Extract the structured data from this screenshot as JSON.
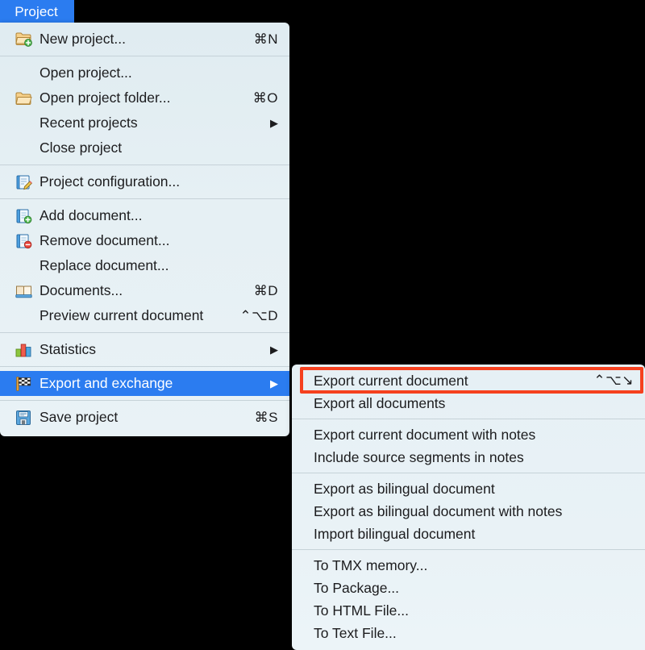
{
  "menubar": {
    "title": "Project"
  },
  "accent": {
    "selection_blue": "#2b7cf0",
    "menu_background": "#e6f0f4",
    "highlight_red": "#f5411f",
    "text": "#1c1c1e"
  },
  "main_menu": {
    "groups": [
      {
        "items": [
          {
            "icon": "new-project-folder-icon",
            "label": "New project...",
            "shortcut": "⌘N",
            "submenu": false
          }
        ]
      },
      {
        "items": [
          {
            "icon": null,
            "label": "Open project...",
            "shortcut": "",
            "submenu": false
          },
          {
            "icon": "open-folder-icon",
            "label": "Open project folder...",
            "shortcut": "⌘O",
            "submenu": false
          },
          {
            "icon": null,
            "label": "Recent projects",
            "shortcut": "",
            "submenu": true
          },
          {
            "icon": null,
            "label": "Close project",
            "shortcut": "",
            "submenu": false
          }
        ]
      },
      {
        "items": [
          {
            "icon": "project-configuration-icon",
            "label": "Project configuration...",
            "shortcut": "",
            "submenu": false
          }
        ]
      },
      {
        "items": [
          {
            "icon": "add-document-icon",
            "label": "Add document...",
            "shortcut": "",
            "submenu": false
          },
          {
            "icon": "remove-document-icon",
            "label": "Remove document...",
            "shortcut": "",
            "submenu": false
          },
          {
            "icon": null,
            "label": "Replace document...",
            "shortcut": "",
            "submenu": false
          },
          {
            "icon": "documents-book-icon",
            "label": "Documents...",
            "shortcut": "⌘D",
            "submenu": false
          },
          {
            "icon": null,
            "label": "Preview current document",
            "shortcut": "⌃⌥D",
            "submenu": false
          }
        ]
      },
      {
        "items": [
          {
            "icon": "statistics-barchart-icon",
            "label": "Statistics",
            "shortcut": "",
            "submenu": true
          }
        ]
      },
      {
        "items": [
          {
            "icon": "export-exchange-flag-icon",
            "label": "Export and exchange",
            "shortcut": "",
            "submenu": true,
            "selected": true
          }
        ]
      },
      {
        "items": [
          {
            "icon": "save-project-floppy-icon",
            "label": "Save project",
            "shortcut": "⌘S",
            "submenu": false
          }
        ]
      }
    ]
  },
  "sub_menu": {
    "groups": [
      {
        "items": [
          {
            "label": "Export current document",
            "shortcut": "⌃⌥↘",
            "highlighted": true
          },
          {
            "label": "Export all documents",
            "shortcut": ""
          }
        ]
      },
      {
        "items": [
          {
            "label": "Export current document with notes",
            "shortcut": ""
          },
          {
            "label": "Include source segments in notes",
            "shortcut": ""
          }
        ]
      },
      {
        "items": [
          {
            "label": "Export as bilingual document",
            "shortcut": ""
          },
          {
            "label": "Export as bilingual document with notes",
            "shortcut": ""
          },
          {
            "label": "Import bilingual document",
            "shortcut": ""
          }
        ]
      },
      {
        "items": [
          {
            "label": "To TMX memory...",
            "shortcut": ""
          },
          {
            "label": "To Package...",
            "shortcut": ""
          },
          {
            "label": "To HTML File...",
            "shortcut": ""
          },
          {
            "label": "To Text File...",
            "shortcut": ""
          }
        ]
      }
    ]
  },
  "annotation": {
    "target_label": "Export current document"
  }
}
